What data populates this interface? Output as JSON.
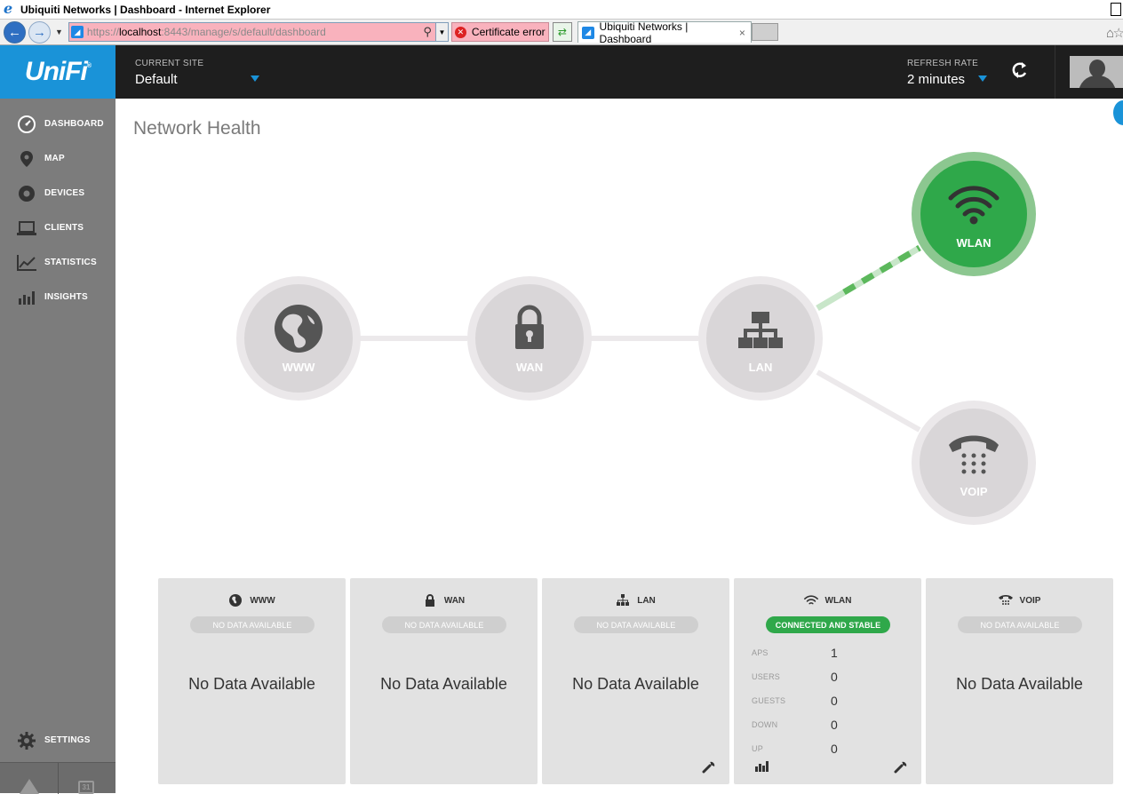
{
  "browser": {
    "window_title": "Ubiquiti Networks | Dashboard - Internet Explorer",
    "url_prefix": "https://",
    "url_host": "localhost",
    "url_rest": ":8443/manage/s/default/dashboard",
    "cert_error": "Certificate error",
    "tab_title": "Ubiquiti Networks | Dashboard",
    "tab_close": "×"
  },
  "sidebar": {
    "logo": "UniFi",
    "logo_mark": "®",
    "items": [
      {
        "label": "DASHBOARD",
        "icon": "dashboard-dial-icon"
      },
      {
        "label": "MAP",
        "icon": "map-pin-icon"
      },
      {
        "label": "DEVICES",
        "icon": "device-circle-icon"
      },
      {
        "label": "CLIENTS",
        "icon": "laptop-icon"
      },
      {
        "label": "STATISTICS",
        "icon": "line-chart-icon"
      },
      {
        "label": "INSIGHTS",
        "icon": "bar-chart-icon"
      }
    ],
    "settings_label": "SETTINGS",
    "calendar_day": "31"
  },
  "topbar": {
    "current_site_label": "CURRENT SITE",
    "current_site_value": "Default",
    "refresh_rate_label": "REFRESH RATE",
    "refresh_rate_value": "2 minutes"
  },
  "page": {
    "title": "Network Health"
  },
  "topology": {
    "nodes": [
      {
        "id": "www",
        "label": "WWW",
        "state": "inactive",
        "icon": "globe-icon"
      },
      {
        "id": "wan",
        "label": "WAN",
        "state": "inactive",
        "icon": "lock-icon"
      },
      {
        "id": "lan",
        "label": "LAN",
        "state": "inactive",
        "icon": "network-icon"
      },
      {
        "id": "wlan",
        "label": "WLAN",
        "state": "active",
        "icon": "wifi-icon"
      },
      {
        "id": "voip",
        "label": "VOIP",
        "state": "inactive",
        "icon": "phone-icon"
      }
    ]
  },
  "cards": {
    "www": {
      "title": "WWW",
      "badge": "NO DATA AVAILABLE",
      "message": "No Data Available"
    },
    "wan": {
      "title": "WAN",
      "badge": "NO DATA AVAILABLE",
      "message": "No Data Available"
    },
    "lan": {
      "title": "LAN",
      "badge": "NO DATA AVAILABLE",
      "message": "No Data Available"
    },
    "wlan": {
      "title": "WLAN",
      "badge": "CONNECTED AND STABLE",
      "stats": [
        {
          "label": "APS",
          "value": "1"
        },
        {
          "label": "USERS",
          "value": "0"
        },
        {
          "label": "GUESTS",
          "value": "0"
        },
        {
          "label": "DOWN",
          "value": "0"
        },
        {
          "label": "UP",
          "value": "0"
        }
      ]
    },
    "voip": {
      "title": "VOIP",
      "badge": "NO DATA AVAILABLE",
      "message": "No Data Available"
    }
  },
  "colors": {
    "brand_blue": "#1a93d8",
    "active_green": "#2fa84a",
    "inactive_node": "#d9d6d8"
  }
}
